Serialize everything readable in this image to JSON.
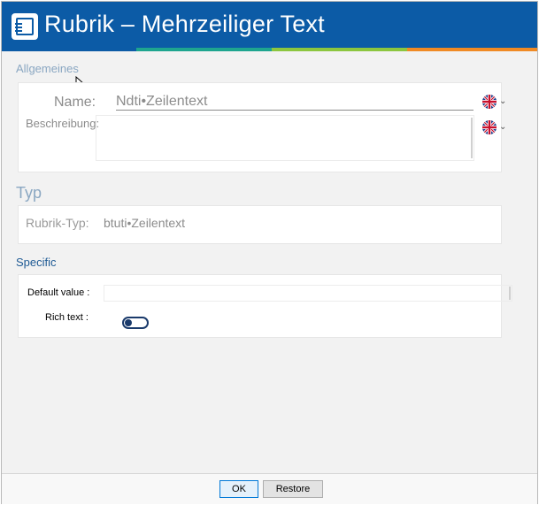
{
  "window": {
    "title": "Rubrik – Mehrzeiliger Text",
    "icon": "text-document-icon",
    "accent_colors": [
      "#0c5ba6",
      "#1ea58f",
      "#8cc63f",
      "#f08a24"
    ]
  },
  "general": {
    "section_label": "Allgemeines",
    "name_label": "Name:",
    "name_value": "Ndti•Zeilentext",
    "description_label": "Beschreibung:",
    "description_value": "",
    "language_icon": "uk-flag-icon"
  },
  "type": {
    "section_label": "Typ",
    "rubric_type_label": "Rubrik-Typ:",
    "rubric_type_value": "btuti•Zeilentext"
  },
  "specific": {
    "section_label": "Specific",
    "default_value_label": "Default value :",
    "default_value": "",
    "rich_text_label": "Rich text :",
    "rich_text_enabled": false
  },
  "footer": {
    "ok_label": "OK",
    "restore_label": "Restore"
  }
}
